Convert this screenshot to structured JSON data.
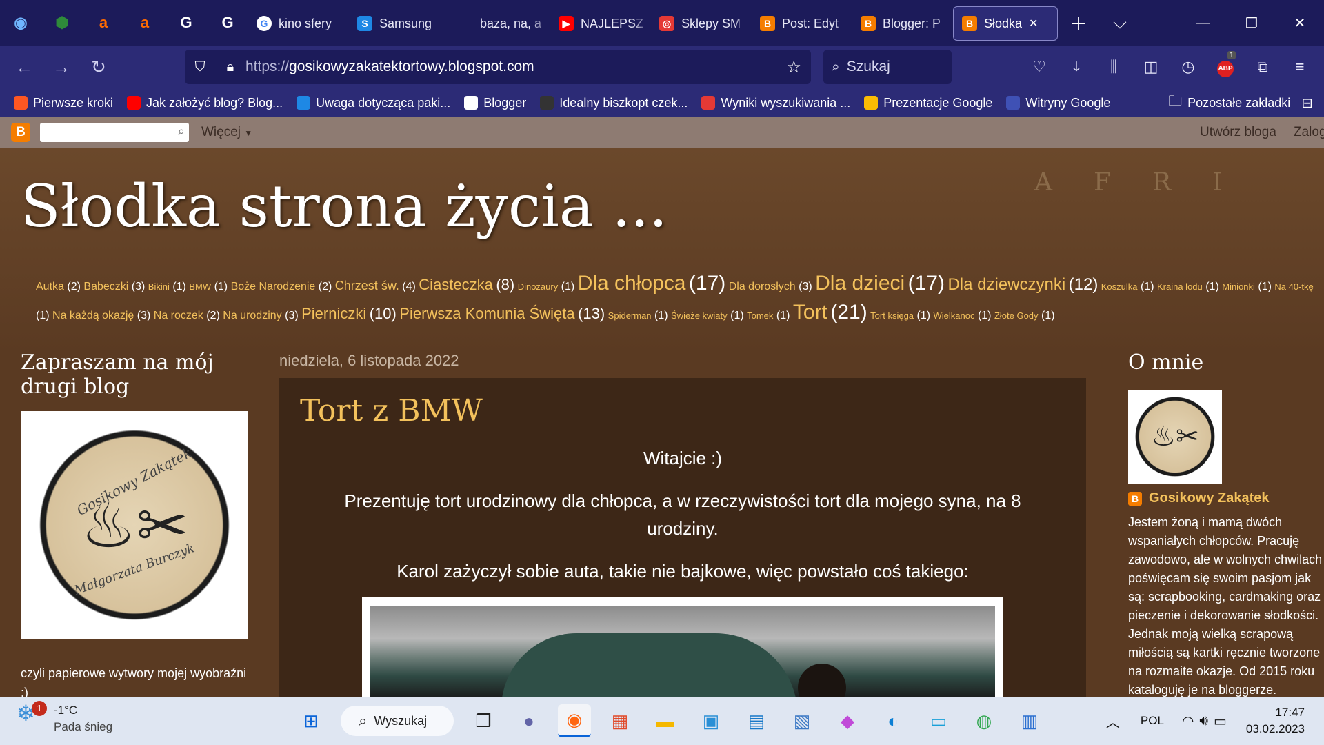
{
  "browser": {
    "pinned_tabs": [
      {
        "icon": "onet-icon",
        "glyph": "◉",
        "color": "#6fb6ff"
      },
      {
        "icon": "badge-icon",
        "glyph": "⬢",
        "color": "#2e8b3a"
      },
      {
        "icon": "allegro-icon",
        "glyph": "a",
        "color": "#ff6a00"
      },
      {
        "icon": "allegro-icon",
        "glyph": "a",
        "color": "#ff6a00"
      },
      {
        "icon": "google-icon",
        "glyph": "G",
        "color": "#ffffff"
      },
      {
        "icon": "google-icon",
        "glyph": "G",
        "color": "#ffffff"
      }
    ],
    "tabs": [
      {
        "label": "kino sfery",
        "icon": "google-icon",
        "glyph": "G",
        "bg": "#ffffff",
        "fg": "#4285f4"
      },
      {
        "label": "Samsung",
        "icon": "skype-icon",
        "glyph": "S",
        "bg": "#1e88e5",
        "fg": "#ffffff"
      },
      {
        "label": "baza, na, a",
        "icon": "blank-icon",
        "glyph": "",
        "bg": "transparent",
        "fg": "#ffffff"
      },
      {
        "label": "NAJLEPSZ",
        "icon": "youtube-icon",
        "glyph": "▶",
        "bg": "#ff0000",
        "fg": "#ffffff"
      },
      {
        "label": "Sklepy SM",
        "icon": "opera-icon",
        "glyph": "◎",
        "bg": "#e53935",
        "fg": "#ffffff"
      },
      {
        "label": "Post: Edyt",
        "icon": "blogger-icon",
        "glyph": "B",
        "bg": "#f57d00",
        "fg": "#ffffff"
      },
      {
        "label": "Blogger: P",
        "icon": "blogger-icon",
        "glyph": "B",
        "bg": "#f57d00",
        "fg": "#ffffff"
      },
      {
        "label": "Słodka",
        "icon": "blogger-icon",
        "glyph": "B",
        "bg": "#f57d00",
        "fg": "#ffffff",
        "active": true
      }
    ],
    "url_prefix": "https://",
    "url_host": "gosikowyzakatektortowy.blogspot.com",
    "search_placeholder": "Szukaj",
    "abp_count": "1",
    "bookmarks": [
      {
        "label": "Pierwsze kroki",
        "color": "#ff5722"
      },
      {
        "label": "Jak założyć blog? Blog...",
        "color": "#ff0000"
      },
      {
        "label": "Uwaga dotycząca paki...",
        "color": "#1e88e5"
      },
      {
        "label": "Blogger",
        "color": "#ffffff"
      },
      {
        "label": "Idealny biszkopt czek...",
        "color": "#333333"
      },
      {
        "label": "Wyniki wyszukiwania ...",
        "color": "#e53935"
      },
      {
        "label": "Prezentacje Google",
        "color": "#fbbc04"
      },
      {
        "label": "Witryny Google",
        "color": "#3f51b5"
      }
    ],
    "other_bookmarks": "Pozostałe zakładki"
  },
  "blogger_nav": {
    "more": "Więcej",
    "create": "Utwórz bloga",
    "login": "Zaloguj"
  },
  "blog": {
    "title": "Słodka strona życia ...",
    "labels": [
      {
        "t": "Autka",
        "n": "(2)",
        "s": 16
      },
      {
        "t": "Babeczki",
        "n": "(3)",
        "s": 16
      },
      {
        "t": "Bikini",
        "n": "(1)",
        "s": 13
      },
      {
        "t": "BMW",
        "n": "(1)",
        "s": 13
      },
      {
        "t": "Boże Narodzenie",
        "n": "(2)",
        "s": 16
      },
      {
        "t": "Chrzest św.",
        "n": "(4)",
        "s": 18
      },
      {
        "t": "Ciasteczka",
        "n": "(8)",
        "s": 22
      },
      {
        "t": "Dinozaury",
        "n": "(1)",
        "s": 13
      },
      {
        "t": "Dla chłopca",
        "n": "(17)",
        "s": 30
      },
      {
        "t": "Dla dorosłych",
        "n": "(3)",
        "s": 16
      },
      {
        "t": "Dla dzieci",
        "n": "(17)",
        "s": 30
      },
      {
        "t": "Dla dziewczynki",
        "n": "(12)",
        "s": 24
      },
      {
        "t": "Koszulka",
        "n": "(1)",
        "s": 13
      },
      {
        "t": "Kraina lodu",
        "n": "(1)",
        "s": 13
      },
      {
        "t": "Minionki",
        "n": "(1)",
        "s": 13
      },
      {
        "t": "Na 40-tkę",
        "n": "(1)",
        "s": 13
      },
      {
        "t": "Na każdą okazję",
        "n": "(3)",
        "s": 16
      },
      {
        "t": "Na roczek",
        "n": "(2)",
        "s": 16
      },
      {
        "t": "Na urodziny",
        "n": "(3)",
        "s": 16
      },
      {
        "t": "Pierniczki",
        "n": "(10)",
        "s": 22
      },
      {
        "t": "Pierwsza Komunia Święta",
        "n": "(13)",
        "s": 22
      },
      {
        "t": "Spiderman",
        "n": "(1)",
        "s": 13
      },
      {
        "t": "Świeże kwiaty",
        "n": "(1)",
        "s": 13
      },
      {
        "t": "Tomek",
        "n": "(1)",
        "s": 13
      },
      {
        "t": "Tort",
        "n": "(21)",
        "s": 30
      },
      {
        "t": "Tort księga",
        "n": "(1)",
        "s": 13
      },
      {
        "t": "Wielkanoc",
        "n": "(1)",
        "s": 13
      },
      {
        "t": "Złote Gody",
        "n": "(1)",
        "s": 13
      }
    ],
    "left_heading": "Zapraszam na mój drugi blog",
    "badge_top": "Gosikowy Zakątek",
    "badge_bottom": "Małgorzata Burczyk",
    "left_text": "czyli papierowe wytwory mojej wyobraźni :)",
    "post_date": "niedziela, 6 listopada 2022",
    "post_title": "Tort z BMW",
    "post_p1": "Witajcie :)",
    "post_p2": "Prezentuję tort urodzinowy dla chłopca, a w rzeczywistości tort dla mojego syna, na 8 urodziny.",
    "post_p3": "Karol zażyczył sobie auta, takie nie bajkowe, więc powstało coś takiego:",
    "about_heading": "O mnie",
    "author": "Gosikowy Zakątek",
    "about_lines": [
      "Jestem żoną i mamą dwóch",
      "wspaniałych chłopców. Pracuję",
      "zawodowo, ale w wolnych chwilach",
      "poświęcam się swoim pasjom jak",
      "są: scrapbooking, cardmaking oraz",
      "pieczenie i dekorowanie słodkości.",
      "Jednak moją wielką scrapową",
      "miłością są kartki ręcznie tworzone",
      "na rozmaite okazje. Od 2015 roku",
      "kataloguję je na bloggerze."
    ]
  },
  "taskbar": {
    "temp": "-1°C",
    "weather": "Pada śnieg",
    "weather_badge": "1",
    "search": "Wyszukaj",
    "apps": [
      {
        "icon": "windows-start-icon",
        "glyph": "⊞",
        "color": "#0a64d8"
      },
      {
        "icon": "task-view-icon",
        "glyph": "❐",
        "color": "#222"
      },
      {
        "icon": "teams-chat-icon",
        "glyph": "●",
        "color": "#6264a7"
      },
      {
        "icon": "firefox-icon",
        "glyph": "◉",
        "color": "#ff6611"
      },
      {
        "icon": "microsoft-store-icon",
        "glyph": "▦",
        "color": "#e04a2a"
      },
      {
        "icon": "file-explorer-icon",
        "glyph": "▬",
        "color": "#f5b800"
      },
      {
        "icon": "photo-viewer-icon",
        "glyph": "▣",
        "color": "#2a8fd6"
      },
      {
        "icon": "network-app-icon",
        "glyph": "▤",
        "color": "#1878c8"
      },
      {
        "icon": "document-app-icon",
        "glyph": "▧",
        "color": "#3b78c4"
      },
      {
        "icon": "paint-icon",
        "glyph": "◆",
        "color": "#c04ad8"
      },
      {
        "icon": "edge-icon",
        "glyph": "◐",
        "color": "#0c7fd4"
      },
      {
        "icon": "monitor-icon",
        "glyph": "▭",
        "color": "#1aa0d8"
      },
      {
        "icon": "chrome-icon",
        "glyph": "◍",
        "color": "#34a853"
      },
      {
        "icon": "notepad-icon",
        "glyph": "▥",
        "color": "#2b6fd0"
      }
    ],
    "lang": "POL",
    "time": "17:47",
    "date": "03.02.2023"
  }
}
